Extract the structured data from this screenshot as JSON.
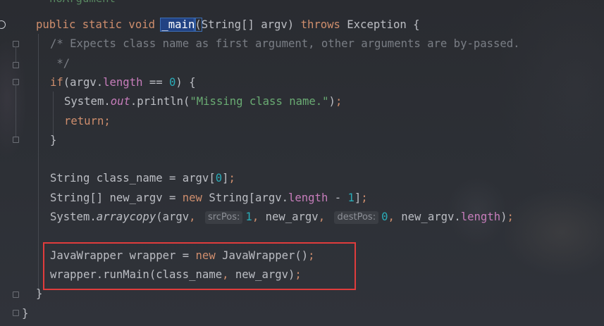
{
  "editor": {
    "top_partial_text": "noArgument",
    "lines": [
      {
        "id": "sig",
        "tokens": [
          [
            "kw",
            "public static void "
          ],
          [
            "fn-hl",
            "_main"
          ],
          [
            "paren-hl",
            "("
          ],
          [
            "",
            "String[] argv) "
          ],
          [
            "kw",
            "throws "
          ],
          [
            "",
            "Exception {"
          ]
        ]
      },
      {
        "id": "c1",
        "tokens": [
          [
            "cm",
            "/* Expects class name as first argument, other arguments are by-passed."
          ]
        ]
      },
      {
        "id": "c2",
        "tokens": [
          [
            "cm",
            " */"
          ]
        ]
      },
      {
        "id": "if",
        "tokens": [
          [
            "kw",
            "if"
          ],
          [
            "",
            "(argv."
          ],
          [
            "fld",
            "length"
          ],
          [
            "",
            " == "
          ],
          [
            "num",
            "0"
          ],
          [
            "",
            ") {"
          ]
        ]
      },
      {
        "id": "print",
        "tokens": [
          [
            "",
            "System."
          ],
          [
            "stat",
            "out"
          ],
          [
            "",
            ".println("
          ],
          [
            "str",
            "\"Missing class name.\""
          ],
          [
            "",
            ")"
          ],
          [
            "kw",
            ";"
          ]
        ]
      },
      {
        "id": "ret",
        "tokens": [
          [
            "kw",
            "return;"
          ]
        ]
      },
      {
        "id": "close1",
        "tokens": [
          [
            "",
            "}"
          ]
        ]
      },
      {
        "id": "blank1",
        "tokens": []
      },
      {
        "id": "cls",
        "tokens": [
          [
            "",
            "String class_name = argv["
          ],
          [
            "num",
            "0"
          ],
          [
            "",
            "]"
          ],
          [
            "kw",
            ";"
          ]
        ]
      },
      {
        "id": "newargv",
        "tokens": [
          [
            "",
            "String[] new_argv = "
          ],
          [
            "kw",
            "new "
          ],
          [
            "",
            "String[argv."
          ],
          [
            "fld",
            "length"
          ],
          [
            "",
            " - "
          ],
          [
            "num",
            "1"
          ],
          [
            "",
            "]"
          ],
          [
            "kw",
            ";"
          ]
        ]
      },
      {
        "id": "copy",
        "tokens": [
          [
            "",
            "System."
          ],
          [
            "ital",
            "arraycopy"
          ],
          [
            "",
            "(argv"
          ],
          [
            "kw",
            ", "
          ],
          [
            "hint",
            "srcPos:"
          ],
          [
            "num",
            "1"
          ],
          [
            "kw",
            ", "
          ],
          [
            "",
            "new_argv"
          ],
          [
            "kw",
            ", "
          ],
          [
            "hint",
            "destPos:"
          ],
          [
            "num",
            "0"
          ],
          [
            "kw",
            ", "
          ],
          [
            "",
            "new_argv."
          ],
          [
            "fld",
            "length"
          ],
          [
            "",
            ")"
          ],
          [
            "kw",
            ";"
          ]
        ]
      },
      {
        "id": "blank2",
        "tokens": []
      },
      {
        "id": "wrap",
        "tokens": [
          [
            "",
            "JavaWrapper wrapper = "
          ],
          [
            "kw",
            "new "
          ],
          [
            "",
            "JavaWrapper()"
          ],
          [
            "kw",
            ";"
          ]
        ]
      },
      {
        "id": "run",
        "tokens": [
          [
            "",
            "wrapper.runMain(class_name"
          ],
          [
            "kw",
            ", "
          ],
          [
            "",
            "new_argv)"
          ],
          [
            "kw",
            ";"
          ]
        ]
      },
      {
        "id": "close2",
        "tokens": [
          [
            "",
            "}"
          ]
        ]
      },
      {
        "id": "close3",
        "tokens": [
          [
            "",
            "}"
          ]
        ]
      }
    ]
  }
}
